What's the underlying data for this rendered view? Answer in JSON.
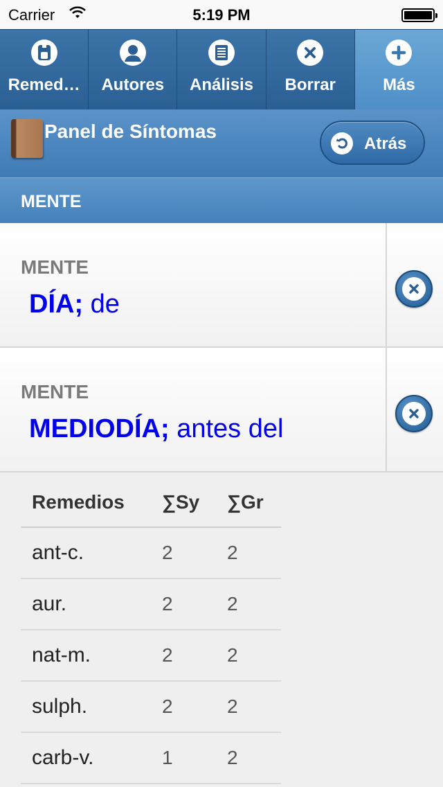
{
  "status_bar": {
    "carrier": "Carrier",
    "time": "5:19 PM"
  },
  "tabs": [
    {
      "label": "Remed…",
      "icon": "remedy-icon",
      "active": false
    },
    {
      "label": "Autores",
      "icon": "person-icon",
      "active": false
    },
    {
      "label": "Análisis",
      "icon": "document-icon",
      "active": false
    },
    {
      "label": "Borrar",
      "icon": "close-icon",
      "active": false
    },
    {
      "label": "Más",
      "icon": "plus-icon",
      "active": true
    }
  ],
  "panel": {
    "title": "Panel de Síntomas",
    "back_label": "Atrás"
  },
  "section": {
    "title": "MENTE"
  },
  "symptoms": [
    {
      "category": "MENTE",
      "rubric_bold": "DÍA;",
      "rubric_rest": " de"
    },
    {
      "category": "MENTE",
      "rubric_bold": "MEDIODÍA;",
      "rubric_rest": " antes del"
    }
  ],
  "table": {
    "headers": [
      "Remedios",
      "∑Sy",
      "∑Gr"
    ],
    "rows": [
      [
        "ant-c.",
        "2",
        "2"
      ],
      [
        "aur.",
        "2",
        "2"
      ],
      [
        "nat-m.",
        "2",
        "2"
      ],
      [
        "sulph.",
        "2",
        "2"
      ],
      [
        "carb-v.",
        "1",
        "2"
      ]
    ]
  },
  "colors": {
    "bar_blue": "#2b5f94",
    "active_tab": "#5b9bd0",
    "link_blue": "#0000ee"
  }
}
